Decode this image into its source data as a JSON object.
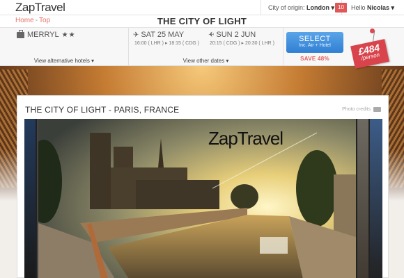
{
  "header": {
    "logo": "ZapTravel",
    "origin_label": "City of origin:",
    "origin_value": "London ▾",
    "notifications": "10",
    "hello_label": "Hello",
    "user_name": "Nicolas ▾"
  },
  "breadcrumb": {
    "home": "Home",
    "separator": "-",
    "current": "Top"
  },
  "page_title": "THE CITY OF LIGHT",
  "booking": {
    "hotel_name": "MERRYL",
    "stars": "★★",
    "hotels_link": "View alternative hotels ▾",
    "outbound_date": "SAT 25 MAY",
    "outbound_times": "16:00 ( LHR ) ▸ 18:15 ( CDG )",
    "return_date": "SUN 2 JUN",
    "return_times": "20:15 ( CDG ) ▸ 20:30 ( LHR )",
    "dates_link": "View other dates ▾",
    "select_label": "SELECT",
    "select_sub": "Inc. Air + Hotel",
    "save_label": "SAVE 48%",
    "price": "£484",
    "per": "/person"
  },
  "panel": {
    "title": "THE CITY OF LIGHT - PARIS, FRANCE",
    "credits": "Photo credits",
    "watermark": "ZapTravel"
  },
  "colors": {
    "accent": "#e0605d",
    "button": "#3a8ad8",
    "tag": "#d9444c"
  },
  "icons": [
    "suitcase-icon",
    "plane-icon",
    "camera-icon",
    "pin-icon"
  ]
}
